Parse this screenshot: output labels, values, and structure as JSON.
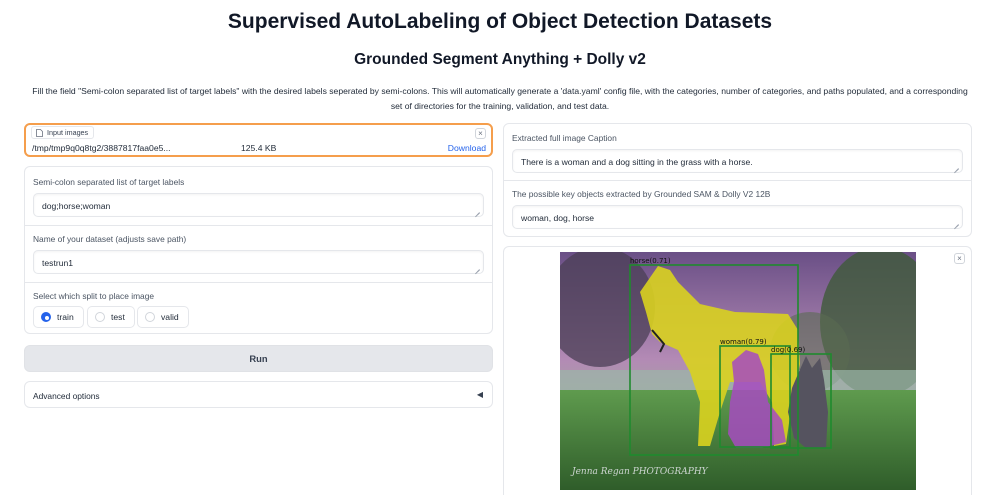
{
  "header": {
    "title": "Supervised AutoLabeling of Object Detection Datasets",
    "subtitle": "Grounded Segment Anything + Dolly v2",
    "description": "Fill the field \"Semi-colon separated list of target labels\" with the desired labels seperated by semi-colons. This will automatically generate a 'data.yaml' config file, with the categories, number of categories, and paths populated, and a corresponding set of directories for the training, validation, and test data."
  },
  "file_input": {
    "label": "Input images",
    "path": "/tmp/tmp9q0q8tg2/3887817faa0e5...",
    "size": "125.4 KB",
    "download": "Download",
    "close": "×"
  },
  "form": {
    "labels_field": {
      "label": "Semi-colon separated list of target labels",
      "value": "dog;horse;woman"
    },
    "dataset_field": {
      "label": "Name of your dataset (adjusts save path)",
      "value": "testrun1"
    },
    "split": {
      "label": "Select which split to place image",
      "options": [
        "train",
        "test",
        "valid"
      ],
      "selected": "train"
    },
    "run_button": "Run",
    "advanced": {
      "label": "Advanced options",
      "arrow": "◀"
    }
  },
  "outputs": {
    "caption": {
      "label": "Extracted full image Caption",
      "value": "There is a woman and a dog sitting in the grass with a horse."
    },
    "objects": {
      "label": "The possible key objects extracted by Grounded SAM & Dolly V2 12B",
      "value": "woman, dog, horse"
    }
  },
  "result_image": {
    "close": "×",
    "detections": [
      {
        "label": "horse(0.71)",
        "color": "#1f8a2e"
      },
      {
        "label": "woman(0.79)",
        "color": "#1f8a2e"
      },
      {
        "label": "dog(0.69)",
        "color": "#1f8a2e"
      }
    ],
    "watermark": "Jenna Regan PHOTOGRAPHY"
  },
  "colors": {
    "accent_orange": "#f59e4c",
    "link_blue": "#2563eb",
    "radio_blue": "#2563eb",
    "button_gray": "#e5e7eb"
  }
}
